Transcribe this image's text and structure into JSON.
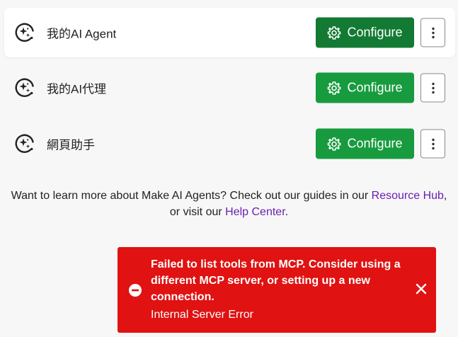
{
  "agents": [
    {
      "name": "我的AI Agent",
      "configure_label": "Configure",
      "icon": "agent-sparkle-icon",
      "active": true
    },
    {
      "name": "我的AI代理",
      "configure_label": "Configure",
      "icon": "agent-sparkle-icon",
      "active": false
    },
    {
      "name": "網頁助手",
      "configure_label": "Configure",
      "icon": "agent-sparkle-icon",
      "active": false
    }
  ],
  "learn_more": {
    "text_1": "Want to learn more about Make AI Agents? Check out our guides in our ",
    "resource_hub_link": "Resource Hub",
    "text_2": ", or visit our ",
    "help_center_link": "Help Center",
    "text_3": "."
  },
  "toast": {
    "message": "Failed to list tools from MCP. Consider using a different MCP server, or setting up a new connection.",
    "detail": "Internal Server Error",
    "icon": "error-icon",
    "close_icon": "close-icon"
  },
  "colors": {
    "configure_button": "#179b3e",
    "configure_button_active": "#127a32",
    "link": "#6a1fb0",
    "toast_background": "#e01212"
  }
}
